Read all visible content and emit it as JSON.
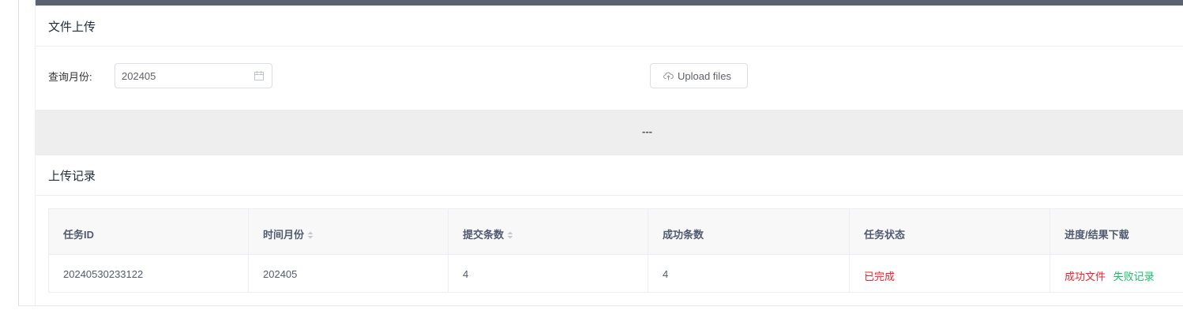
{
  "upload_section": {
    "title": "文件上传",
    "month_label": "查询月份:",
    "month_value": "202405",
    "upload_button": "Upload files"
  },
  "divider": {
    "text": "---"
  },
  "records_section": {
    "title": "上传记录",
    "columns": [
      "任务ID",
      "时间月份",
      "提交条数",
      "成功条数",
      "任务状态",
      "进度/结果下载"
    ],
    "rows": [
      {
        "task_id": "20240530233122",
        "month": "202405",
        "submitted": "4",
        "succeeded": "4",
        "status": "已完成",
        "success_file": "成功文件",
        "fail_record": "失败记录"
      }
    ]
  },
  "colors": {
    "topbar": "#5b6270",
    "status_done": "#f5222d",
    "success_link": "#f5222d",
    "fail_link": "#19be6b"
  },
  "icons": {
    "calendar": "calendar-icon",
    "upload": "cloud-upload-icon",
    "sort": "sort-icon"
  }
}
